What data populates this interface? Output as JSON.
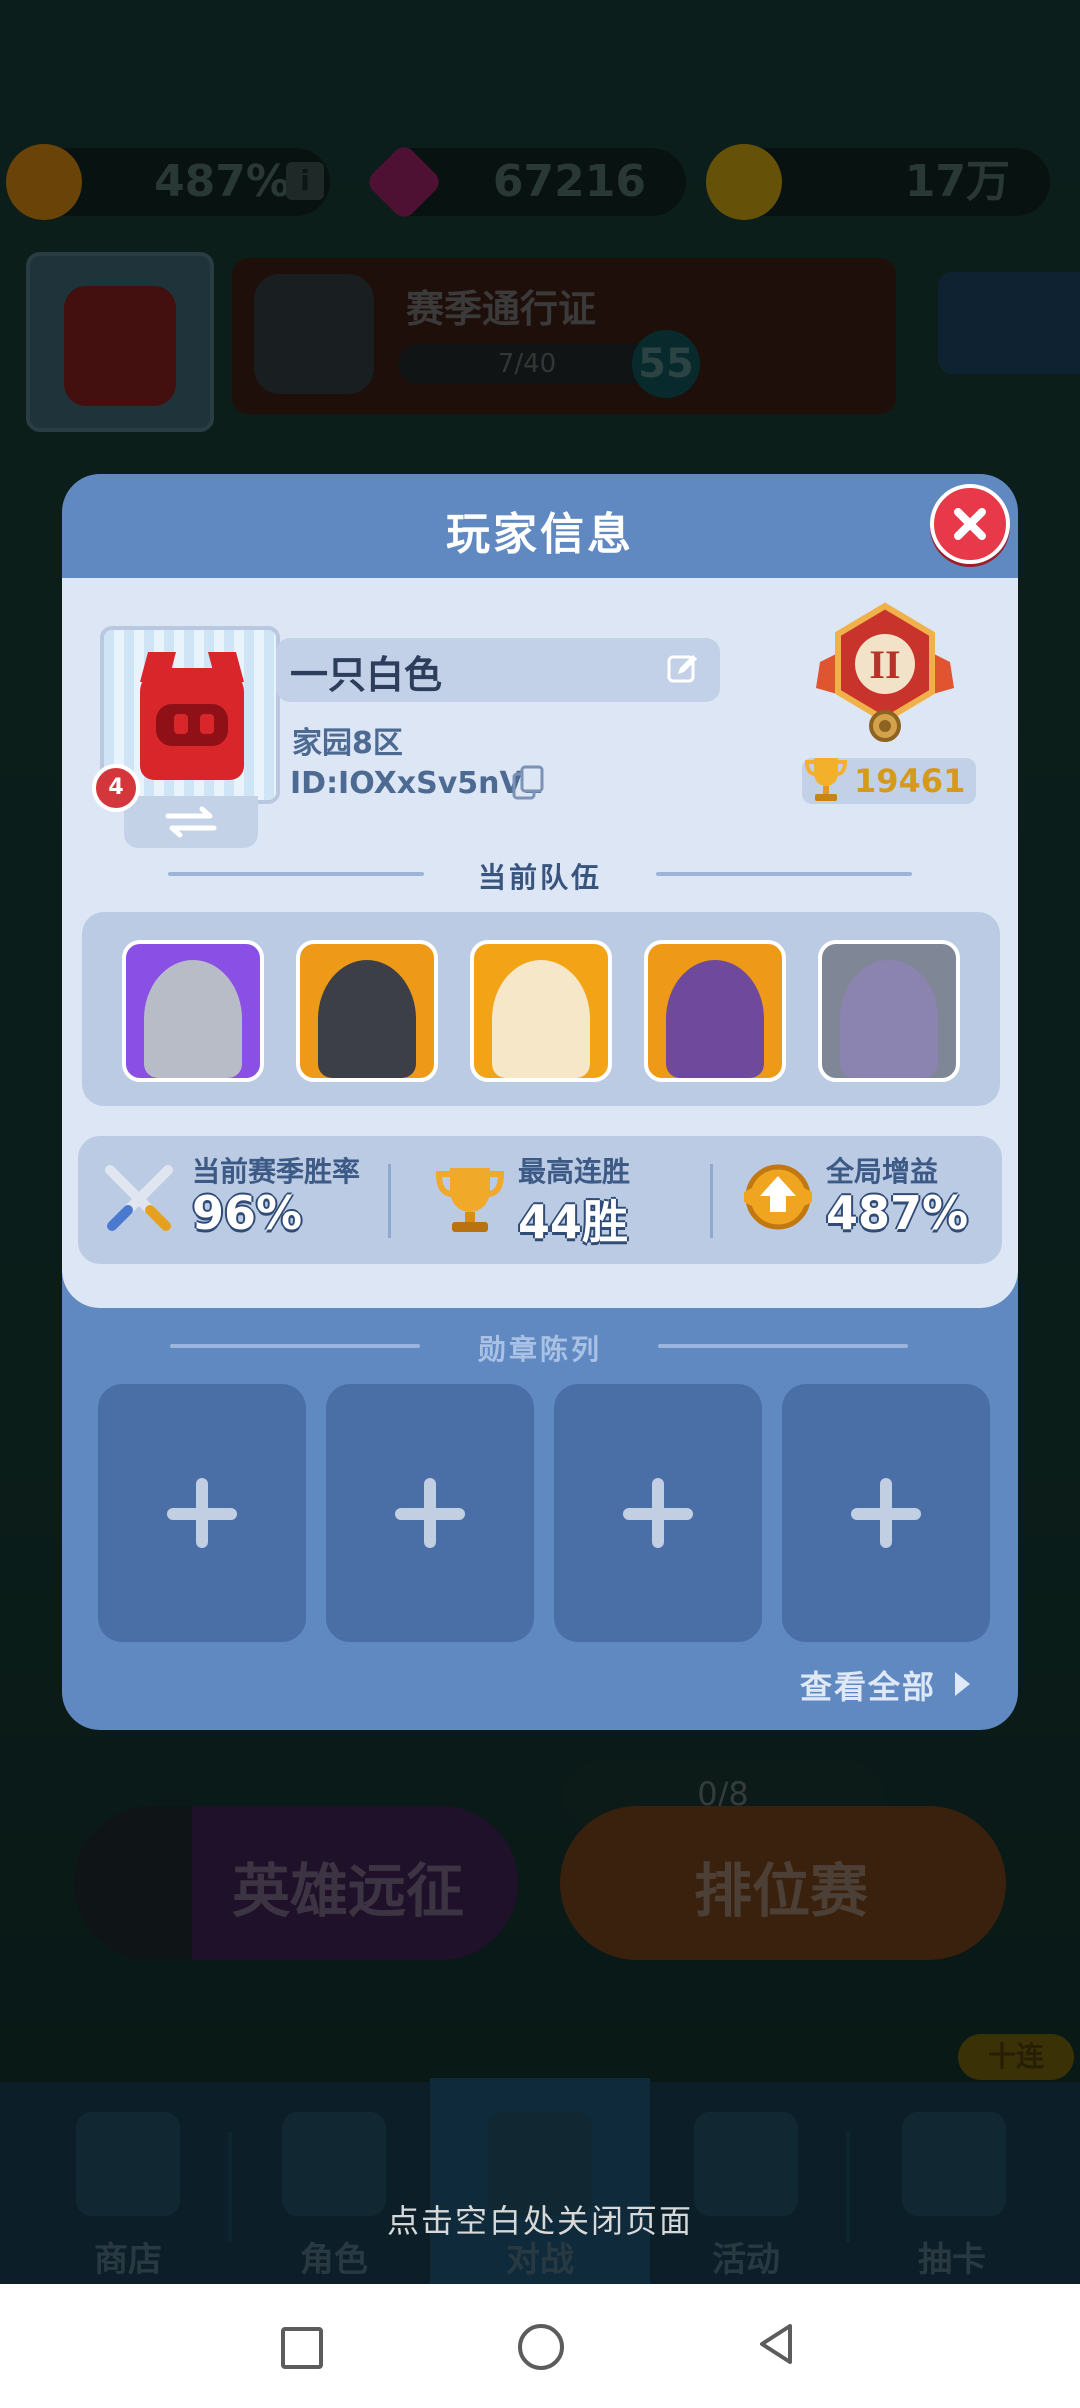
{
  "hud": {
    "boost_percent": "487%",
    "gems": "67216",
    "coins": "17万",
    "season_pass_title": "赛季通行证",
    "season_pass_progress": "7/40",
    "season_pass_level": "55",
    "player_level_badge": "4",
    "match_counter": "0/8",
    "expedition_label": "英雄远征",
    "ranked_label": "排位赛",
    "ten_pull_label": "十连"
  },
  "nav": {
    "shop": "商店",
    "heroes": "角色",
    "battle": "对战",
    "events": "活动",
    "draw": "抽卡"
  },
  "close_hint": "点击空白处关闭页面",
  "modal": {
    "title": "玩家信息",
    "player": {
      "name": "一只白色",
      "server": "家园8区",
      "id_text": "ID:IOXxSv5nVL",
      "level": "4",
      "rank_roman": "II",
      "trophies": "19461"
    },
    "team_title": "当前队伍",
    "team": [
      "knight",
      "dark-knight",
      "angel",
      "dark-mage",
      "hooded-archer"
    ],
    "stats": [
      {
        "label": "当前赛季胜率",
        "value": "96%",
        "icon": "crossed-swords-icon"
      },
      {
        "label": "最高连胜",
        "value": "44胜",
        "icon": "trophy-cup-icon"
      },
      {
        "label": "全局增益",
        "value": "487%",
        "icon": "boost-badge-icon"
      }
    ],
    "badges_title": "勋章陈列",
    "badge_slots": 4,
    "view_all": "查看全部"
  },
  "colors": {
    "modal_blue": "#6089c2",
    "panel_light": "#dde6f5",
    "close_red": "#e8394a",
    "trophy_gold": "#d69a1a"
  }
}
